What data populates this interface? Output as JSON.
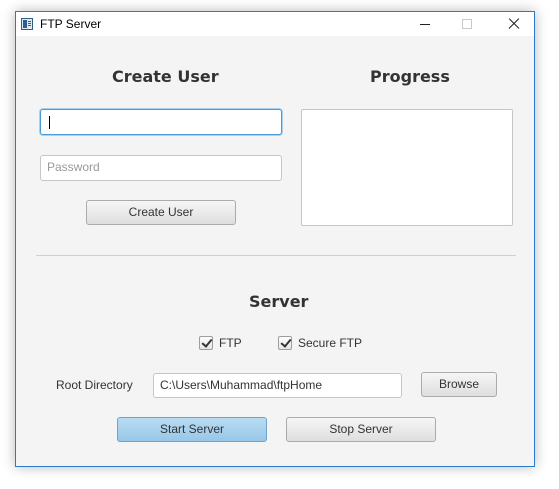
{
  "window": {
    "title": "FTP Server"
  },
  "create_user": {
    "heading": "Create User",
    "username_value": "",
    "password_placeholder": "Password",
    "button_label": "Create User"
  },
  "progress": {
    "heading": "Progress",
    "log_text": ""
  },
  "server": {
    "heading": "Server",
    "ftp_label": "FTP",
    "ftp_checked": true,
    "secure_ftp_label": "Secure FTP",
    "secure_ftp_checked": true,
    "root_directory_label": "Root Directory",
    "root_directory_value": "C:\\Users\\Muhammad\\ftpHome",
    "browse_label": "Browse",
    "start_label": "Start Server",
    "stop_label": "Stop Server"
  },
  "icons": {
    "app": "app-window-icon",
    "minimize": "minimize-icon",
    "maximize": "maximize-icon",
    "close": "close-icon"
  }
}
